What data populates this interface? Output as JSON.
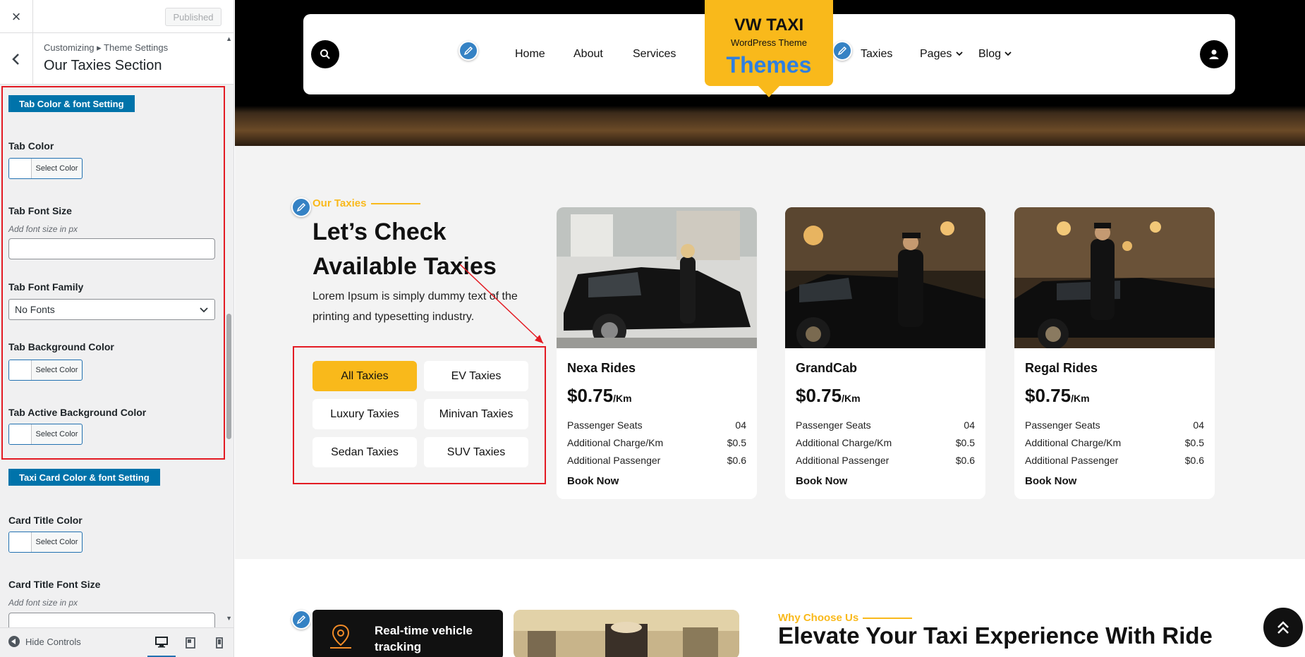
{
  "customizer": {
    "close_icon": "×",
    "publish_label": "Published",
    "breadcrumb": "Customizing ▸ Theme Settings",
    "section_title": "Our Taxies Section",
    "tab_group_title": "Tab Color & font Setting",
    "card_group_title": "Taxi Card Color & font Setting",
    "fields": {
      "tab_color": "Tab Color",
      "tab_font_size": "Tab Font Size",
      "tab_font_size_hint": "Add font size in px",
      "tab_font_family": "Tab Font Family",
      "tab_font_family_value": "No Fonts",
      "tab_bg_color": "Tab Background Color",
      "tab_active_bg_color": "Tab Active Background Color",
      "card_title_color": "Card Title Color",
      "card_title_font_size": "Card Title Font Size",
      "card_title_font_size_hint": "Add font size in px"
    },
    "select_color_label": "Select Color",
    "hide_controls_label": "Hide Controls"
  },
  "site": {
    "nav": {
      "home": "Home",
      "about": "About",
      "services": "Services",
      "taxies": "Taxies",
      "pages": "Pages",
      "blog": "Blog"
    },
    "logo": {
      "line1": "VW TAXI",
      "line2": "WordPress Theme",
      "line3": "Themes"
    }
  },
  "taxies_section": {
    "subtitle": "Our Taxies",
    "title_line1": "Let’s Check",
    "title_line2": "Available Taxies",
    "desc_line1": "Lorem Ipsum is simply dummy text of the",
    "desc_line2": "printing and typesetting industry.",
    "tabs": [
      "All Taxies",
      "EV Taxies",
      "Luxury Taxies",
      "Minivan Taxies",
      "Sedan Taxies",
      "SUV Taxies"
    ],
    "cards": [
      {
        "name": "Nexa Rides",
        "price": "$0.75",
        "unit": "/Km",
        "specs": [
          [
            "Passenger Seats",
            "04"
          ],
          [
            "Additional Charge/Km",
            "$0.5"
          ],
          [
            "Additional Passenger",
            "$0.6"
          ]
        ],
        "cta": "Book Now"
      },
      {
        "name": "GrandCab",
        "price": "$0.75",
        "unit": "/Km",
        "specs": [
          [
            "Passenger Seats",
            "04"
          ],
          [
            "Additional Charge/Km",
            "$0.5"
          ],
          [
            "Additional Passenger",
            "$0.6"
          ]
        ],
        "cta": "Book Now"
      },
      {
        "name": "Regal Rides",
        "price": "$0.75",
        "unit": "/Km",
        "specs": [
          [
            "Passenger Seats",
            "04"
          ],
          [
            "Additional Charge/Km",
            "$0.5"
          ],
          [
            "Additional Passenger",
            "$0.6"
          ]
        ],
        "cta": "Book Now"
      }
    ]
  },
  "why_section": {
    "feature_label": "Real-time vehicle tracking",
    "subtitle": "Why Choose Us",
    "title": "Elevate Your Taxi Experience With Ride"
  },
  "colors": {
    "accent": "#f9b91b",
    "admin_blue": "#0073aa",
    "highlight_red": "#e31b23",
    "logo_blue": "#2f7fe0"
  }
}
